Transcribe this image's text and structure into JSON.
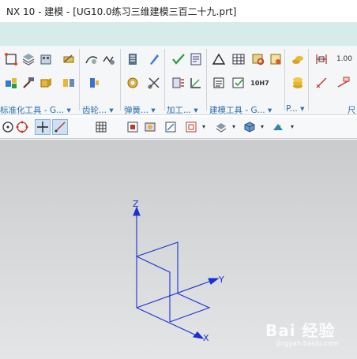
{
  "window": {
    "title": "NX 10 - 建模 - [UG10.0练习三维建模三百二十九.prt]"
  },
  "ribbon": {
    "groups": [
      {
        "label": "标准化工具 - G...",
        "icon": "chevron-down-icon"
      },
      {
        "label": "齿轮...",
        "icon": "chevron-down-icon"
      },
      {
        "label": "弹簧...",
        "icon": "chevron-down-icon"
      },
      {
        "label": "加工...",
        "icon": "chevron-down-icon"
      },
      {
        "label": "建模工具 - G...",
        "icon": "chevron-down-icon"
      },
      {
        "label": "P...",
        "icon": "chevron-down-icon"
      },
      {
        "label": "尺"
      }
    ],
    "text_buttons": {
      "dimension_value": "1.00",
      "tolerance": "10H7"
    }
  },
  "view_toolbar": {
    "icons": [
      "circle-snap-icon",
      "quadrant-point-icon",
      "crosshair-icon",
      "line-tool-icon",
      "grid-icon",
      "view-fit-icon",
      "render-icon",
      "orient-view-icon",
      "shading-icon",
      "layer-icon",
      "edit-section-icon"
    ]
  },
  "viewport": {
    "axes": {
      "x": "X",
      "y": "Y",
      "z": "Z"
    },
    "watermark": {
      "main": "Bai 经验",
      "sub": "jingyan.baidu.com"
    }
  },
  "colors": {
    "axis": "#1a2fd6",
    "ribbon_band": "#d6ecea",
    "group_label": "#2a6fb0"
  }
}
